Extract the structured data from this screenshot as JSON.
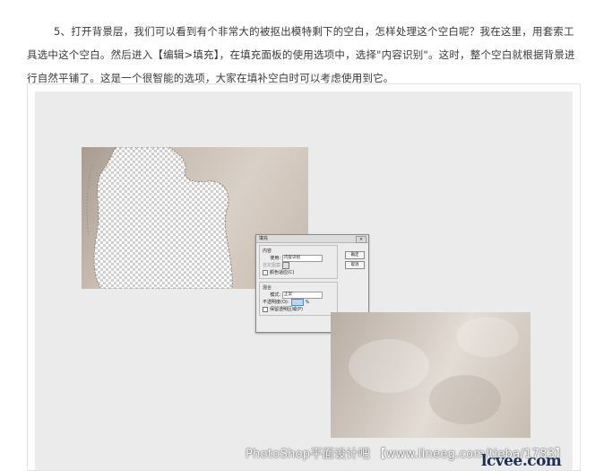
{
  "article": {
    "paragraph": "5、打开背景层，我们可以看到有个非常大的被抠出模特剩下的空白，怎样处理这个空白呢？我在这里，用套索工具选中这个空白。然后进入【编辑>填充】，在填充面板的使用选项中，选择\"内容识别\"。这时，整个空白就根据背景进行自然平铺了。这是一个很智能的选项，大家在填补空白时可以考虑使用到它。"
  },
  "dialog": {
    "title": "填充",
    "close": "×",
    "contents_group": "内容",
    "use_label": "使用:",
    "use_value": "内容识别",
    "custom_pattern_label": "自定图案:",
    "color_adapt": "颜色适应(C)",
    "blending_group": "混合",
    "mode_label": "模式:",
    "mode_value": "正常",
    "opacity_label": "不透明度(O):",
    "opacity_unit": "%",
    "preserve_transparency": "保留透明区域(P)",
    "ok_button": "确定",
    "cancel_button": "取消"
  },
  "watermark": {
    "text": "PhotoShop平面设计吧 【www.lineeg.com/tieba/1783】",
    "logo": "lcvee.com"
  },
  "colors": {
    "canvas_bg": "#ebebeb",
    "photo_tone": "#d2c9c1",
    "logo": "#1d2f55"
  }
}
